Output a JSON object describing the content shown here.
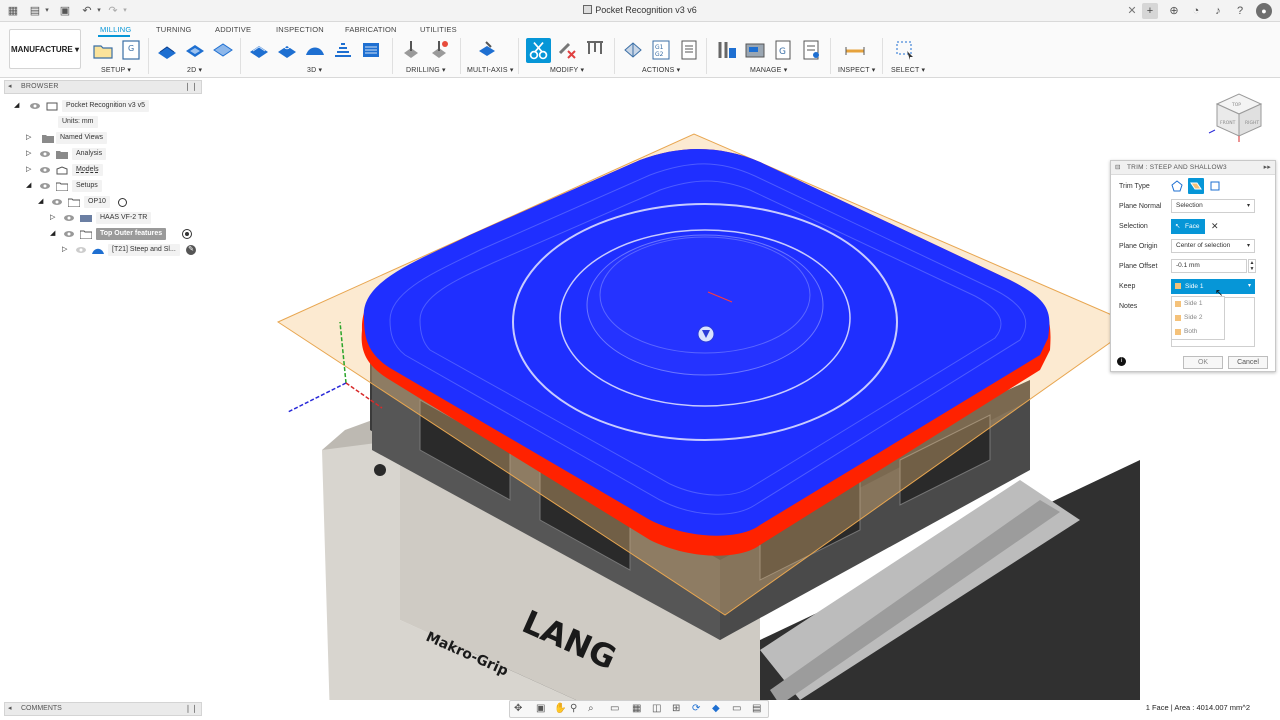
{
  "window": {
    "title": "Pocket Recognition v3 v6"
  },
  "ribbon": {
    "workspace": "MANUFACTURE",
    "tabs": [
      "MILLING",
      "TURNING",
      "ADDITIVE",
      "INSPECTION",
      "FABRICATION",
      "UTILITIES"
    ],
    "active_tab": "MILLING",
    "groups": [
      "SETUP",
      "2D",
      "3D",
      "DRILLING",
      "MULTI-AXIS",
      "MODIFY",
      "ACTIONS",
      "MANAGE",
      "INSPECT",
      "SELECT"
    ],
    "accent": "#0696d7"
  },
  "browser": {
    "header": "BROWSER",
    "items": [
      {
        "label": "Pocket Recognition v3 v5"
      },
      {
        "label": "Units: mm"
      },
      {
        "label": "Named Views"
      },
      {
        "label": "Analysis"
      },
      {
        "label": "Models"
      },
      {
        "label": "Setups"
      },
      {
        "label": "OP10"
      },
      {
        "label": "HAAS VF-2 TR"
      },
      {
        "label": "Top Outer features"
      },
      {
        "label": "[T21] Steep and Sl..."
      }
    ]
  },
  "comments": {
    "header": "COMMENTS"
  },
  "dialog": {
    "title": "TRIM : STEEP AND SHALLOW3",
    "rows": {
      "trim_type": "Trim Type",
      "plane_normal": "Plane Normal",
      "plane_normal_value": "Selection",
      "selection": "Selection",
      "selection_value": "Face",
      "plane_origin": "Plane Origin",
      "plane_origin_value": "Center of selection",
      "plane_offset": "Plane Offset",
      "plane_offset_value": "-0.1 mm",
      "keep": "Keep",
      "keep_value": "Side 1",
      "notes": "Notes"
    },
    "keep_options": [
      "Side 1",
      "Side 2",
      "Both"
    ],
    "ok": "OK",
    "cancel": "Cancel"
  },
  "viewcube": {
    "faces": [
      "TOP",
      "FRONT",
      "RIGHT"
    ]
  },
  "scene": {
    "vise_brand": "Makro-Grip",
    "vise_logo": "LANG",
    "toolpath_color": "#1f2fff",
    "boundary_color": "#ff2200",
    "plane_color": "#f5c27a"
  },
  "status": {
    "text": "1 Face | Area : 4014.007 mm^2"
  }
}
